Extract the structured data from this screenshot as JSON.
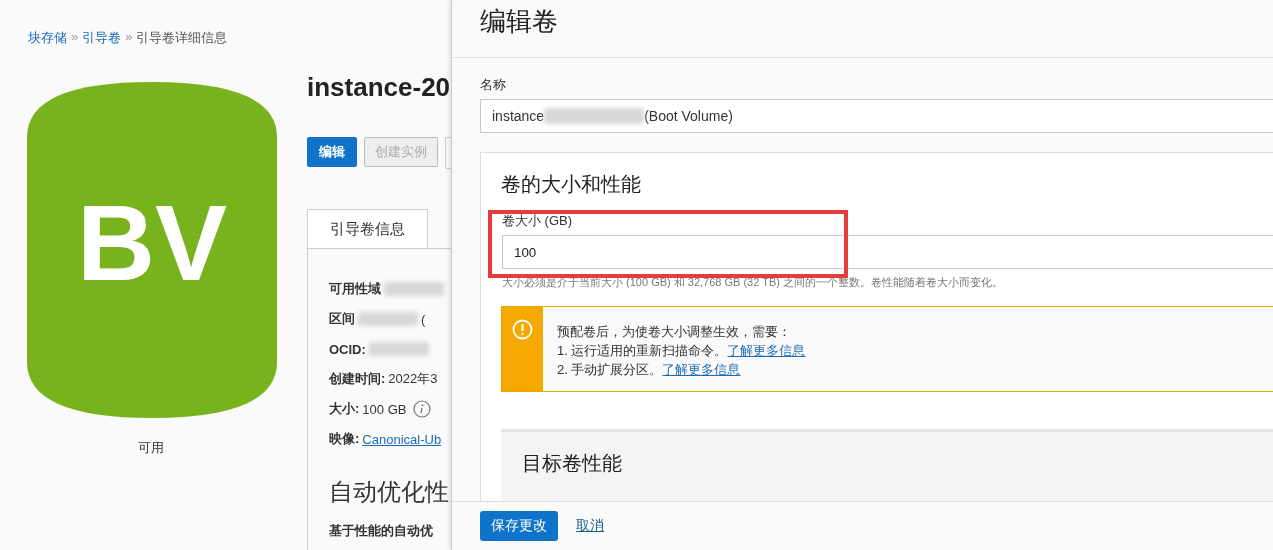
{
  "breadcrumb_separator": "»",
  "breadcrumb": [
    {
      "label": "块存储",
      "link": true
    },
    {
      "label": "引导卷",
      "link": true
    },
    {
      "label": "引导卷详细信息",
      "link": false
    }
  ],
  "logo": {
    "letters": "BV",
    "status": "可用"
  },
  "page": {
    "title": "instance-20",
    "buttons": [
      {
        "label": "编辑",
        "disabled": false
      },
      {
        "label": "创建实例",
        "disabled": true
      }
    ],
    "tabs": [
      {
        "label": "引导卷信息",
        "selected": true
      }
    ],
    "details": [
      {
        "label": "可用性域",
        "redacted": true
      },
      {
        "label": "区间",
        "value": "(",
        "redacted": true,
        "link": false
      },
      {
        "label": "OCID:",
        "redacted": true
      },
      {
        "label": "创建时间:",
        "value": "2022年3",
        "redacted": false,
        "link": false
      },
      {
        "label": "大小:",
        "value": "100 GB",
        "redacted": false,
        "link": false,
        "info": true
      },
      {
        "label": "映像:",
        "value": "Canonical-Ub",
        "redacted": false,
        "link": true
      }
    ],
    "section_title": "自动优化性",
    "section_label": "基于性能的自动优"
  },
  "panel": {
    "title": "编辑卷",
    "name_label": "名称",
    "name_prefix": "instance",
    "name_suffix": "(Boot Volume)",
    "section_title": "卷的大小和性能",
    "size_label": "卷大小 (GB)",
    "size_value": "100",
    "size_help": "大小必须是介于当前大小 (100 GB) 和 32,768 GB (32 TB) 之间的一个整数。卷性能随着卷大小而变化。",
    "warning": {
      "intro": "预配卷后，为使卷大小调整生效，需要：",
      "steps": [
        {
          "text": "1. 运行适用的重新扫描命令。",
          "link": "了解更多信息"
        },
        {
          "text": "2. 手动扩展分区。",
          "link": "了解更多信息"
        }
      ]
    },
    "subsection_title": "目标卷性能",
    "save": "保存更改",
    "cancel": "取消"
  }
}
